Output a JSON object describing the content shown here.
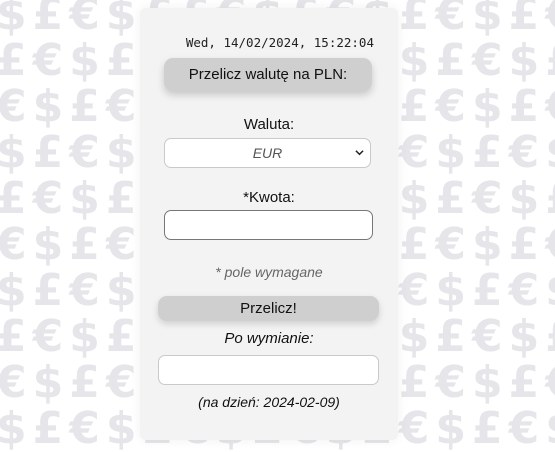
{
  "background": {
    "pattern_rows": [
      "$£€$££€$£€$£€$£€$£€$£€",
      "£€$£€$£€$£€$£€$£€$£€$£",
      "€$£€$£€$£€$£€$£€$£€$£€",
      "$£€$£€$£€$£€$£€$£€$£€$",
      "£€$£€$£€$£€$£€$£€$£€$£",
      "€$£€$£€$£€$£€$£€$£€$£€",
      "$£€$£€$£€$£€$£€$£€$£€$",
      "£€$£€$£€$£€$£€$£€$£€$£",
      "€$£€$£€$£€$£€$£€$£€$£€",
      "$£€$£€$£€$£€$£€$£€$£€$"
    ],
    "pattern_color": "#e6e6ea"
  },
  "panel": {
    "datetime": "Wed, 14/02/2024, 15:22:04",
    "title_button": "Przelicz walutę na PLN:",
    "currency_label": "Waluta:",
    "currency_selected": "EUR",
    "amount_label": "*Kwota:",
    "amount_value": "",
    "required_note": "* pole wymagane",
    "convert_button": "Przelicz!",
    "result_label": "Po wymianie:",
    "result_value": "",
    "rate_date_note": "(na dzień: 2024-02-09)"
  },
  "colors": {
    "panel_bg": "#f3f3f3",
    "button_bg": "#cfcfcf"
  }
}
